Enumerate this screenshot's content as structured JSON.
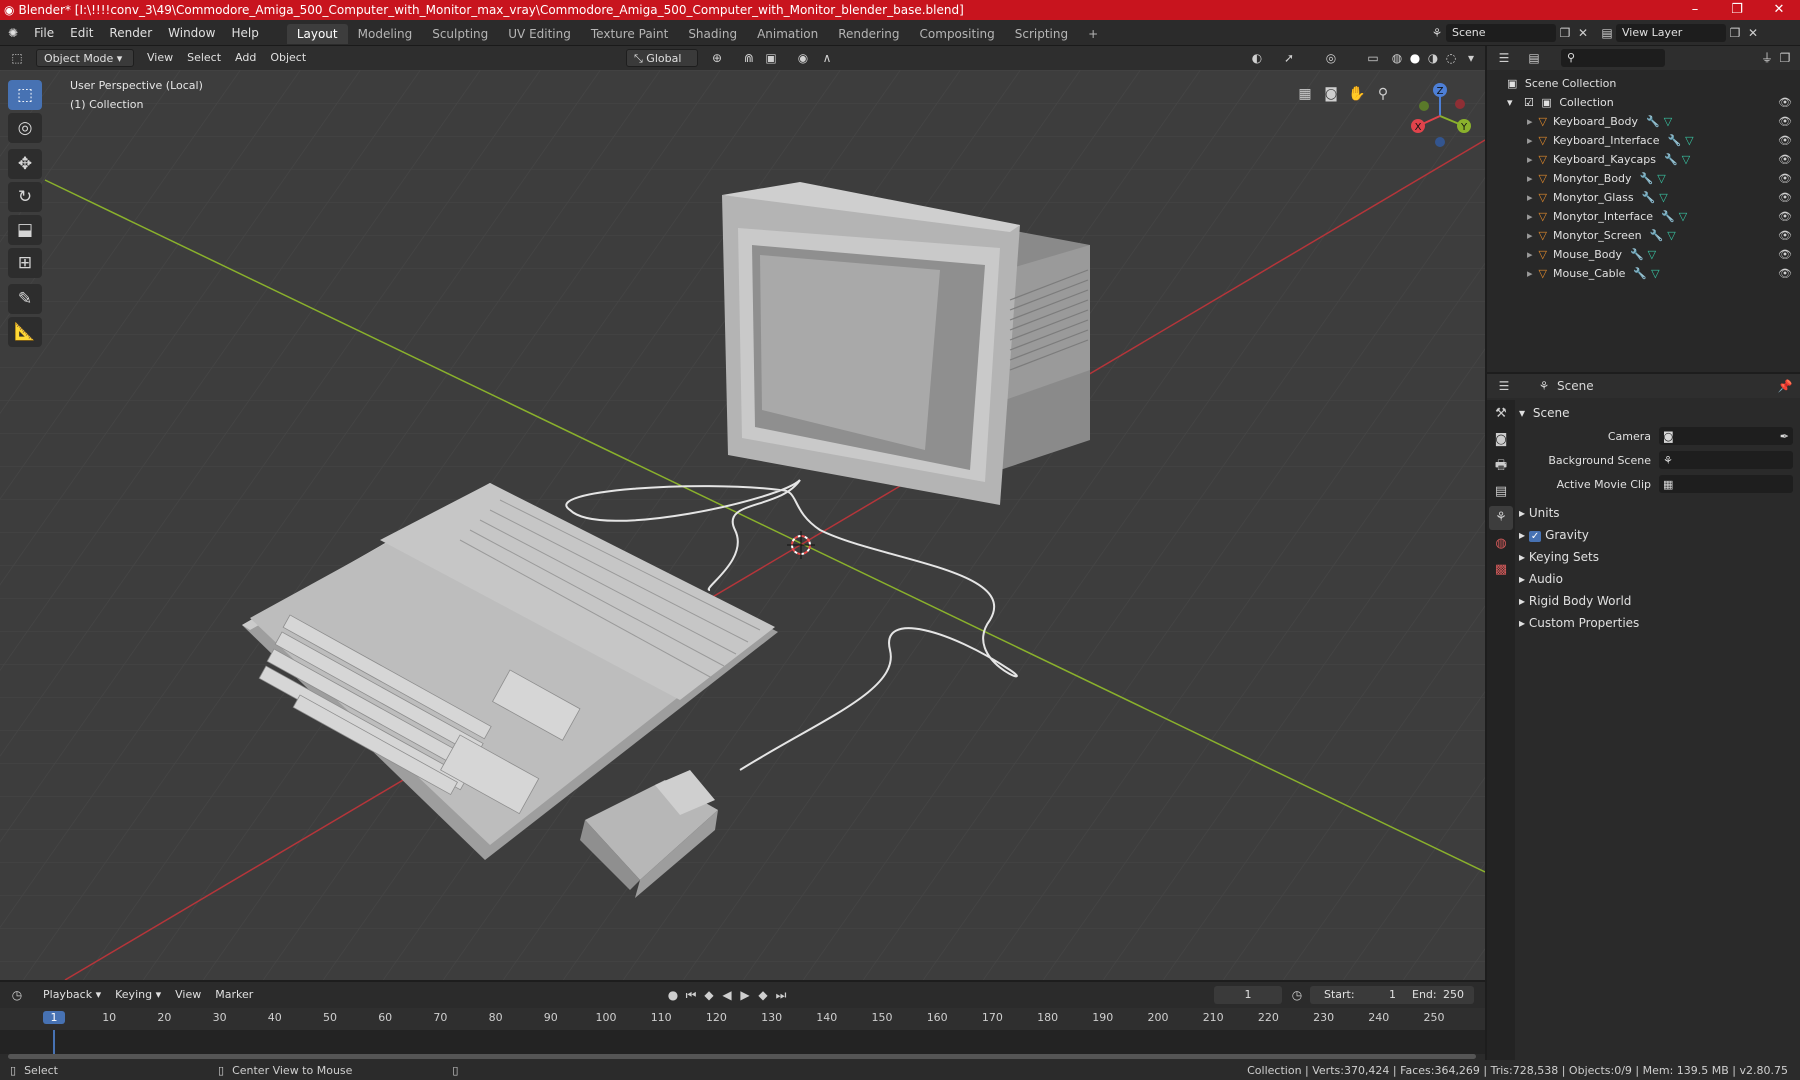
{
  "window": {
    "title": "Blender* [I:\\!!!!conv_3\\49\\Commodore_Amiga_500_Computer_with_Monitor_max_vray\\Commodore_Amiga_500_Computer_with_Monitor_blender_base.blend]",
    "minimize": "–",
    "maximize": "❐",
    "close": "✕"
  },
  "menu": [
    "File",
    "Edit",
    "Render",
    "Window",
    "Help"
  ],
  "workspaces": [
    "Layout",
    "Modeling",
    "Sculpting",
    "UV Editing",
    "Texture Paint",
    "Shading",
    "Animation",
    "Rendering",
    "Compositing",
    "Scripting"
  ],
  "add_workspace": "+",
  "scene_field": "Scene",
  "view_layer_field": "View Layer",
  "viewport_header": {
    "mode": "Object Mode",
    "menus": [
      "View",
      "Select",
      "Add",
      "Object"
    ],
    "transform": "Global"
  },
  "viewport": {
    "perspective": "User Perspective (Local)",
    "collection": "(1) Collection",
    "gizmo": {
      "x": "X",
      "y": "Y",
      "z": "Z"
    }
  },
  "outliner": {
    "search_placeholder": "",
    "scene_collection": "Scene Collection",
    "collection": "Collection",
    "objects": [
      "Keyboard_Body",
      "Keyboard_Interface",
      "Keyboard_Kaycaps",
      "Monytor_Body",
      "Monytor_Glass",
      "Monytor_Interface",
      "Monytor_Screen",
      "Mouse_Body",
      "Mouse_Cable"
    ]
  },
  "properties": {
    "header": "Scene",
    "panel": "Scene",
    "fields": [
      {
        "label": "Camera"
      },
      {
        "label": "Background Scene"
      },
      {
        "label": "Active Movie Clip"
      }
    ],
    "subpanels": [
      "Units",
      "Gravity",
      "Keying Sets",
      "Audio",
      "Rigid Body World",
      "Custom Properties"
    ]
  },
  "timeline": {
    "menus": [
      "Playback",
      "Keying",
      "View",
      "Marker"
    ],
    "current_frame": "1",
    "start_label": "Start:",
    "start": "1",
    "end_label": "End:",
    "end": "250",
    "ticks": [
      "1",
      "10",
      "20",
      "30",
      "40",
      "50",
      "60",
      "70",
      "80",
      "90",
      "100",
      "110",
      "120",
      "130",
      "140",
      "150",
      "160",
      "170",
      "180",
      "190",
      "200",
      "210",
      "220",
      "230",
      "240",
      "250"
    ]
  },
  "status": {
    "select": "Select",
    "center": "Center View to Mouse",
    "stats": "Collection | Verts:370,424 | Faces:364,269 | Tris:728,538 | Objects:0/9 | Mem: 139.5 MB | v2.80.75"
  },
  "colors": {
    "titlebar": "#c8141e",
    "accent": "#4772b3",
    "axis_x": "#b5353a",
    "axis_y": "#8ab12c",
    "object_icon": "#e38b2c",
    "mesh_icon": "#39c6a4"
  }
}
